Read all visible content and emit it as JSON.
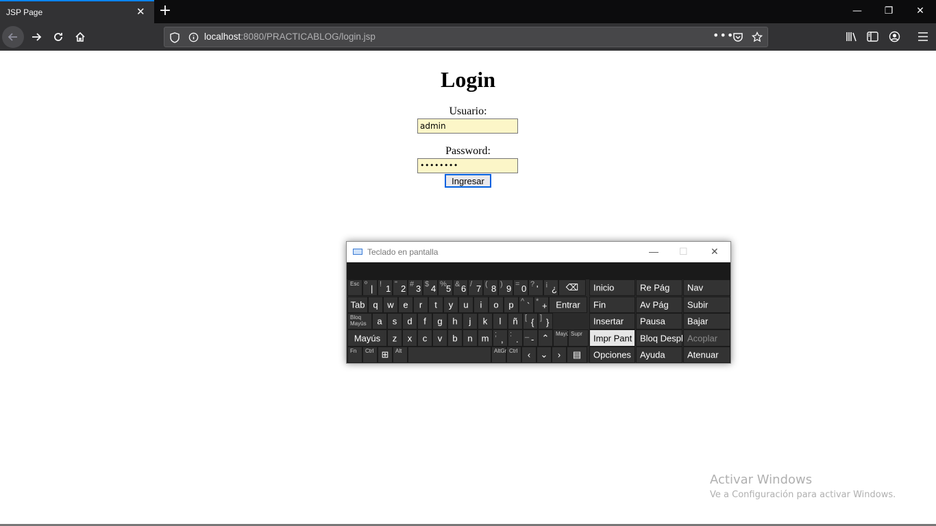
{
  "browser": {
    "tab_title": "JSP Page",
    "tab_close": "✕",
    "new_tab": "+",
    "url_host": "localhost",
    "url_path": ":8080/PRACTICABLOG/login.jsp",
    "window_controls": {
      "minimize": "—",
      "restore": "❐",
      "close": "✕"
    },
    "icons": [
      "back-icon",
      "forward-icon",
      "reload-icon",
      "home-icon",
      "shield-icon",
      "info-icon",
      "more-icon",
      "pocket-icon",
      "star-icon",
      "library-icon",
      "sidebar-icon",
      "account-icon",
      "menu-icon"
    ]
  },
  "page": {
    "title": "Login",
    "user_label": "Usuario:",
    "user_value": "admin",
    "pass_label": "Password:",
    "pass_value": "••••••••",
    "submit_label": "Ingresar"
  },
  "osk": {
    "title": "Teclado en pantalla",
    "controls": {
      "minimize": "—",
      "maximize": "☐",
      "close": "✕"
    },
    "rows": [
      [
        {
          "m": "",
          "s": "Esc"
        },
        {
          "m": "|",
          "tp": "º"
        },
        {
          "m": "1",
          "tp": "!"
        },
        {
          "m": "2",
          "tp": "\""
        },
        {
          "m": "3",
          "tp": "#"
        },
        {
          "m": "4",
          "tp": "$"
        },
        {
          "m": "5",
          "tp": "%"
        },
        {
          "m": "6",
          "tp": "&"
        },
        {
          "m": "7",
          "tp": "/"
        },
        {
          "m": "8",
          "tp": "("
        },
        {
          "m": "9",
          "tp": ")"
        },
        {
          "m": "0",
          "tp": "="
        },
        {
          "m": "'",
          "tp": "?"
        },
        {
          "m": "¿",
          "tp": "¡"
        },
        {
          "m": "⌫"
        }
      ],
      [
        {
          "m": "Tab"
        },
        {
          "m": "q"
        },
        {
          "m": "w"
        },
        {
          "m": "e"
        },
        {
          "m": "r"
        },
        {
          "m": "t"
        },
        {
          "m": "y"
        },
        {
          "m": "u"
        },
        {
          "m": "i"
        },
        {
          "m": "o"
        },
        {
          "m": "p"
        },
        {
          "m": "`",
          "tp": "^"
        },
        {
          "m": "+",
          "tp": "*"
        },
        {
          "m": "Entrar"
        }
      ],
      [
        {
          "m": "",
          "s": "Bloq Mayús"
        },
        {
          "m": "a"
        },
        {
          "m": "s"
        },
        {
          "m": "d"
        },
        {
          "m": "f"
        },
        {
          "m": "g"
        },
        {
          "m": "h"
        },
        {
          "m": "j"
        },
        {
          "m": "k"
        },
        {
          "m": "l"
        },
        {
          "m": "ñ"
        },
        {
          "m": "{",
          "tp": "["
        },
        {
          "m": "}",
          "tp": "]"
        }
      ],
      [
        {
          "m": "Mayús"
        },
        {
          "m": "z"
        },
        {
          "m": "x"
        },
        {
          "m": "c"
        },
        {
          "m": "v"
        },
        {
          "m": "b"
        },
        {
          "m": "n"
        },
        {
          "m": "m"
        },
        {
          "m": ",",
          "tp": ";"
        },
        {
          "m": ".",
          "tp": ":"
        },
        {
          "m": "-",
          "tp": "_"
        },
        {
          "m": "⌃"
        },
        {
          "m": "",
          "s": "Mayús"
        },
        {
          "m": "",
          "s": "Supr"
        }
      ],
      [
        {
          "m": "",
          "s": "Fn"
        },
        {
          "m": "",
          "s": "Ctrl"
        },
        {
          "m": "⊞"
        },
        {
          "m": "",
          "s": "Alt"
        },
        {
          "m": ""
        },
        {
          "m": "",
          "s": "AltGr"
        },
        {
          "m": "",
          "s": "Ctrl"
        },
        {
          "m": "‹"
        },
        {
          "m": "⌄"
        },
        {
          "m": "›"
        },
        {
          "m": "▤"
        }
      ]
    ],
    "nav_keys": [
      [
        "Inicio",
        "Re Pág",
        "Nav"
      ],
      [
        "Fin",
        "Av Pág",
        "Subir"
      ],
      [
        "Insertar",
        "Pausa",
        "Bajar"
      ],
      [
        "Impr Pant",
        "Bloq Despl",
        "Acoplar"
      ],
      [
        "Opciones",
        "Ayuda",
        "Atenuar"
      ]
    ]
  },
  "watermark": {
    "line1": "Activar Windows",
    "line2": "Ve a Configuración para activar Windows."
  }
}
